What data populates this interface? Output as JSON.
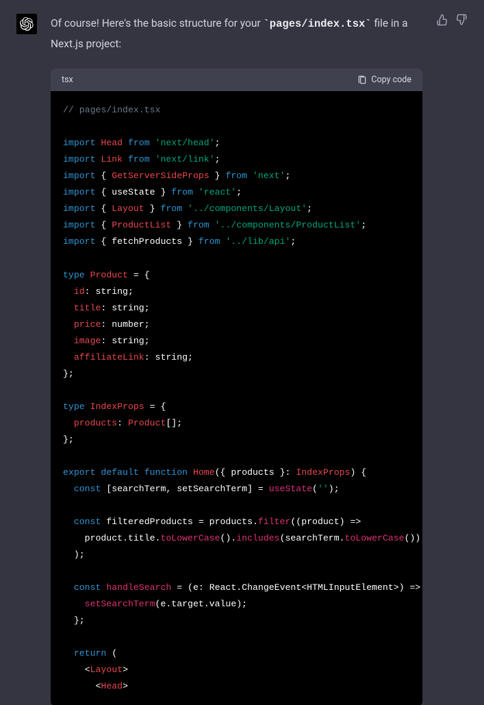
{
  "message": {
    "intro_prefix": "Of course! Here's the basic structure for your ",
    "inline_code": "`pages/index.tsx`",
    "intro_suffix": " file in a Next.js project:"
  },
  "code_block": {
    "lang": "tsx",
    "copy_label": "Copy code",
    "lines": [
      [
        [
          "comment",
          "// pages/index.tsx"
        ]
      ],
      [],
      [
        [
          "kw",
          "import"
        ],
        [
          "plain",
          " "
        ],
        [
          "red",
          "Head"
        ],
        [
          "plain",
          " "
        ],
        [
          "kw",
          "from"
        ],
        [
          "plain",
          " "
        ],
        [
          "str",
          "'next/head'"
        ],
        [
          "plain",
          ";"
        ]
      ],
      [
        [
          "kw",
          "import"
        ],
        [
          "plain",
          " "
        ],
        [
          "red",
          "Link"
        ],
        [
          "plain",
          " "
        ],
        [
          "kw",
          "from"
        ],
        [
          "plain",
          " "
        ],
        [
          "str",
          "'next/link'"
        ],
        [
          "plain",
          ";"
        ]
      ],
      [
        [
          "kw",
          "import"
        ],
        [
          "plain",
          " { "
        ],
        [
          "red",
          "GetServerSideProps"
        ],
        [
          "plain",
          " } "
        ],
        [
          "kw",
          "from"
        ],
        [
          "plain",
          " "
        ],
        [
          "str",
          "'next'"
        ],
        [
          "plain",
          ";"
        ]
      ],
      [
        [
          "kw",
          "import"
        ],
        [
          "plain",
          " { useState } "
        ],
        [
          "kw",
          "from"
        ],
        [
          "plain",
          " "
        ],
        [
          "str",
          "'react'"
        ],
        [
          "plain",
          ";"
        ]
      ],
      [
        [
          "kw",
          "import"
        ],
        [
          "plain",
          " { "
        ],
        [
          "red",
          "Layout"
        ],
        [
          "plain",
          " } "
        ],
        [
          "kw",
          "from"
        ],
        [
          "plain",
          " "
        ],
        [
          "str",
          "'../components/Layout'"
        ],
        [
          "plain",
          ";"
        ]
      ],
      [
        [
          "kw",
          "import"
        ],
        [
          "plain",
          " { "
        ],
        [
          "red",
          "ProductList"
        ],
        [
          "plain",
          " } "
        ],
        [
          "kw",
          "from"
        ],
        [
          "plain",
          " "
        ],
        [
          "str",
          "'../components/ProductList'"
        ],
        [
          "plain",
          ";"
        ]
      ],
      [
        [
          "kw",
          "import"
        ],
        [
          "plain",
          " { fetchProducts } "
        ],
        [
          "kw",
          "from"
        ],
        [
          "plain",
          " "
        ],
        [
          "str",
          "'../lib/api'"
        ],
        [
          "plain",
          ";"
        ]
      ],
      [],
      [
        [
          "kw",
          "type"
        ],
        [
          "plain",
          " "
        ],
        [
          "red",
          "Product"
        ],
        [
          "plain",
          " = {"
        ]
      ],
      [
        [
          "plain",
          "  "
        ],
        [
          "red",
          "id"
        ],
        [
          "plain",
          ": string;"
        ]
      ],
      [
        [
          "plain",
          "  "
        ],
        [
          "red",
          "title"
        ],
        [
          "plain",
          ": string;"
        ]
      ],
      [
        [
          "plain",
          "  "
        ],
        [
          "red",
          "price"
        ],
        [
          "plain",
          ": number;"
        ]
      ],
      [
        [
          "plain",
          "  "
        ],
        [
          "red",
          "image"
        ],
        [
          "plain",
          ": string;"
        ]
      ],
      [
        [
          "plain",
          "  "
        ],
        [
          "red",
          "affiliateLink"
        ],
        [
          "plain",
          ": string;"
        ]
      ],
      [
        [
          "plain",
          "};"
        ]
      ],
      [],
      [
        [
          "kw",
          "type"
        ],
        [
          "plain",
          " "
        ],
        [
          "red",
          "IndexProps"
        ],
        [
          "plain",
          " = {"
        ]
      ],
      [
        [
          "plain",
          "  "
        ],
        [
          "red",
          "products"
        ],
        [
          "plain",
          ": "
        ],
        [
          "red",
          "Product"
        ],
        [
          "plain",
          "[];"
        ]
      ],
      [
        [
          "plain",
          "};"
        ]
      ],
      [],
      [
        [
          "kw",
          "export"
        ],
        [
          "plain",
          " "
        ],
        [
          "kw",
          "default"
        ],
        [
          "plain",
          " "
        ],
        [
          "kw",
          "function"
        ],
        [
          "plain",
          " "
        ],
        [
          "red",
          "Home"
        ],
        [
          "plain",
          "({ products }: "
        ],
        [
          "red",
          "IndexProps"
        ],
        [
          "plain",
          ") {"
        ]
      ],
      [
        [
          "plain",
          "  "
        ],
        [
          "kw",
          "const"
        ],
        [
          "plain",
          " [searchTerm, setSearchTerm] = "
        ],
        [
          "func",
          "useState"
        ],
        [
          "plain",
          "("
        ],
        [
          "str",
          "''"
        ],
        [
          "plain",
          ");"
        ]
      ],
      [],
      [
        [
          "plain",
          "  "
        ],
        [
          "kw",
          "const"
        ],
        [
          "plain",
          " filteredProducts = products."
        ],
        [
          "func",
          "filter"
        ],
        [
          "plain",
          "("
        ],
        [
          "plain",
          "(product) =>"
        ]
      ],
      [
        [
          "plain",
          "    product.title."
        ],
        [
          "func",
          "toLowerCase"
        ],
        [
          "plain",
          "()."
        ],
        [
          "func",
          "includes"
        ],
        [
          "plain",
          "(searchTerm."
        ],
        [
          "func",
          "toLowerCase"
        ],
        [
          "plain",
          "())"
        ]
      ],
      [
        [
          "plain",
          "  );"
        ]
      ],
      [],
      [
        [
          "plain",
          "  "
        ],
        [
          "kw",
          "const"
        ],
        [
          "plain",
          " "
        ],
        [
          "func",
          "handleSearch"
        ],
        [
          "plain",
          " = (e: React.ChangeEvent<HTMLInputElement>) => {"
        ]
      ],
      [
        [
          "plain",
          "    "
        ],
        [
          "func",
          "setSearchTerm"
        ],
        [
          "plain",
          "(e.target.value);"
        ]
      ],
      [
        [
          "plain",
          "  };"
        ]
      ],
      [],
      [
        [
          "plain",
          "  "
        ],
        [
          "kw",
          "return"
        ],
        [
          "plain",
          " ("
        ]
      ],
      [
        [
          "plain",
          "    <"
        ],
        [
          "red",
          "Layout"
        ],
        [
          "plain",
          ">"
        ]
      ],
      [
        [
          "plain",
          "      <"
        ],
        [
          "red",
          "Head"
        ],
        [
          "plain",
          ">"
        ]
      ]
    ]
  }
}
